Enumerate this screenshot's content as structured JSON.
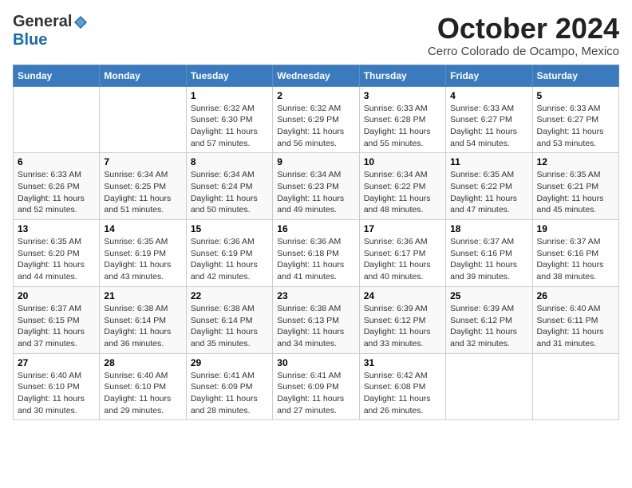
{
  "header": {
    "logo_general": "General",
    "logo_blue": "Blue",
    "month_title": "October 2024",
    "subtitle": "Cerro Colorado de Ocampo, Mexico"
  },
  "weekdays": [
    "Sunday",
    "Monday",
    "Tuesday",
    "Wednesday",
    "Thursday",
    "Friday",
    "Saturday"
  ],
  "weeks": [
    [
      {
        "day": "",
        "info": ""
      },
      {
        "day": "",
        "info": ""
      },
      {
        "day": "1",
        "info": "Sunrise: 6:32 AM\nSunset: 6:30 PM\nDaylight: 11 hours and 57 minutes."
      },
      {
        "day": "2",
        "info": "Sunrise: 6:32 AM\nSunset: 6:29 PM\nDaylight: 11 hours and 56 minutes."
      },
      {
        "day": "3",
        "info": "Sunrise: 6:33 AM\nSunset: 6:28 PM\nDaylight: 11 hours and 55 minutes."
      },
      {
        "day": "4",
        "info": "Sunrise: 6:33 AM\nSunset: 6:27 PM\nDaylight: 11 hours and 54 minutes."
      },
      {
        "day": "5",
        "info": "Sunrise: 6:33 AM\nSunset: 6:27 PM\nDaylight: 11 hours and 53 minutes."
      }
    ],
    [
      {
        "day": "6",
        "info": "Sunrise: 6:33 AM\nSunset: 6:26 PM\nDaylight: 11 hours and 52 minutes."
      },
      {
        "day": "7",
        "info": "Sunrise: 6:34 AM\nSunset: 6:25 PM\nDaylight: 11 hours and 51 minutes."
      },
      {
        "day": "8",
        "info": "Sunrise: 6:34 AM\nSunset: 6:24 PM\nDaylight: 11 hours and 50 minutes."
      },
      {
        "day": "9",
        "info": "Sunrise: 6:34 AM\nSunset: 6:23 PM\nDaylight: 11 hours and 49 minutes."
      },
      {
        "day": "10",
        "info": "Sunrise: 6:34 AM\nSunset: 6:22 PM\nDaylight: 11 hours and 48 minutes."
      },
      {
        "day": "11",
        "info": "Sunrise: 6:35 AM\nSunset: 6:22 PM\nDaylight: 11 hours and 47 minutes."
      },
      {
        "day": "12",
        "info": "Sunrise: 6:35 AM\nSunset: 6:21 PM\nDaylight: 11 hours and 45 minutes."
      }
    ],
    [
      {
        "day": "13",
        "info": "Sunrise: 6:35 AM\nSunset: 6:20 PM\nDaylight: 11 hours and 44 minutes."
      },
      {
        "day": "14",
        "info": "Sunrise: 6:35 AM\nSunset: 6:19 PM\nDaylight: 11 hours and 43 minutes."
      },
      {
        "day": "15",
        "info": "Sunrise: 6:36 AM\nSunset: 6:19 PM\nDaylight: 11 hours and 42 minutes."
      },
      {
        "day": "16",
        "info": "Sunrise: 6:36 AM\nSunset: 6:18 PM\nDaylight: 11 hours and 41 minutes."
      },
      {
        "day": "17",
        "info": "Sunrise: 6:36 AM\nSunset: 6:17 PM\nDaylight: 11 hours and 40 minutes."
      },
      {
        "day": "18",
        "info": "Sunrise: 6:37 AM\nSunset: 6:16 PM\nDaylight: 11 hours and 39 minutes."
      },
      {
        "day": "19",
        "info": "Sunrise: 6:37 AM\nSunset: 6:16 PM\nDaylight: 11 hours and 38 minutes."
      }
    ],
    [
      {
        "day": "20",
        "info": "Sunrise: 6:37 AM\nSunset: 6:15 PM\nDaylight: 11 hours and 37 minutes."
      },
      {
        "day": "21",
        "info": "Sunrise: 6:38 AM\nSunset: 6:14 PM\nDaylight: 11 hours and 36 minutes."
      },
      {
        "day": "22",
        "info": "Sunrise: 6:38 AM\nSunset: 6:14 PM\nDaylight: 11 hours and 35 minutes."
      },
      {
        "day": "23",
        "info": "Sunrise: 6:38 AM\nSunset: 6:13 PM\nDaylight: 11 hours and 34 minutes."
      },
      {
        "day": "24",
        "info": "Sunrise: 6:39 AM\nSunset: 6:12 PM\nDaylight: 11 hours and 33 minutes."
      },
      {
        "day": "25",
        "info": "Sunrise: 6:39 AM\nSunset: 6:12 PM\nDaylight: 11 hours and 32 minutes."
      },
      {
        "day": "26",
        "info": "Sunrise: 6:40 AM\nSunset: 6:11 PM\nDaylight: 11 hours and 31 minutes."
      }
    ],
    [
      {
        "day": "27",
        "info": "Sunrise: 6:40 AM\nSunset: 6:10 PM\nDaylight: 11 hours and 30 minutes."
      },
      {
        "day": "28",
        "info": "Sunrise: 6:40 AM\nSunset: 6:10 PM\nDaylight: 11 hours and 29 minutes."
      },
      {
        "day": "29",
        "info": "Sunrise: 6:41 AM\nSunset: 6:09 PM\nDaylight: 11 hours and 28 minutes."
      },
      {
        "day": "30",
        "info": "Sunrise: 6:41 AM\nSunset: 6:09 PM\nDaylight: 11 hours and 27 minutes."
      },
      {
        "day": "31",
        "info": "Sunrise: 6:42 AM\nSunset: 6:08 PM\nDaylight: 11 hours and 26 minutes."
      },
      {
        "day": "",
        "info": ""
      },
      {
        "day": "",
        "info": ""
      }
    ]
  ]
}
